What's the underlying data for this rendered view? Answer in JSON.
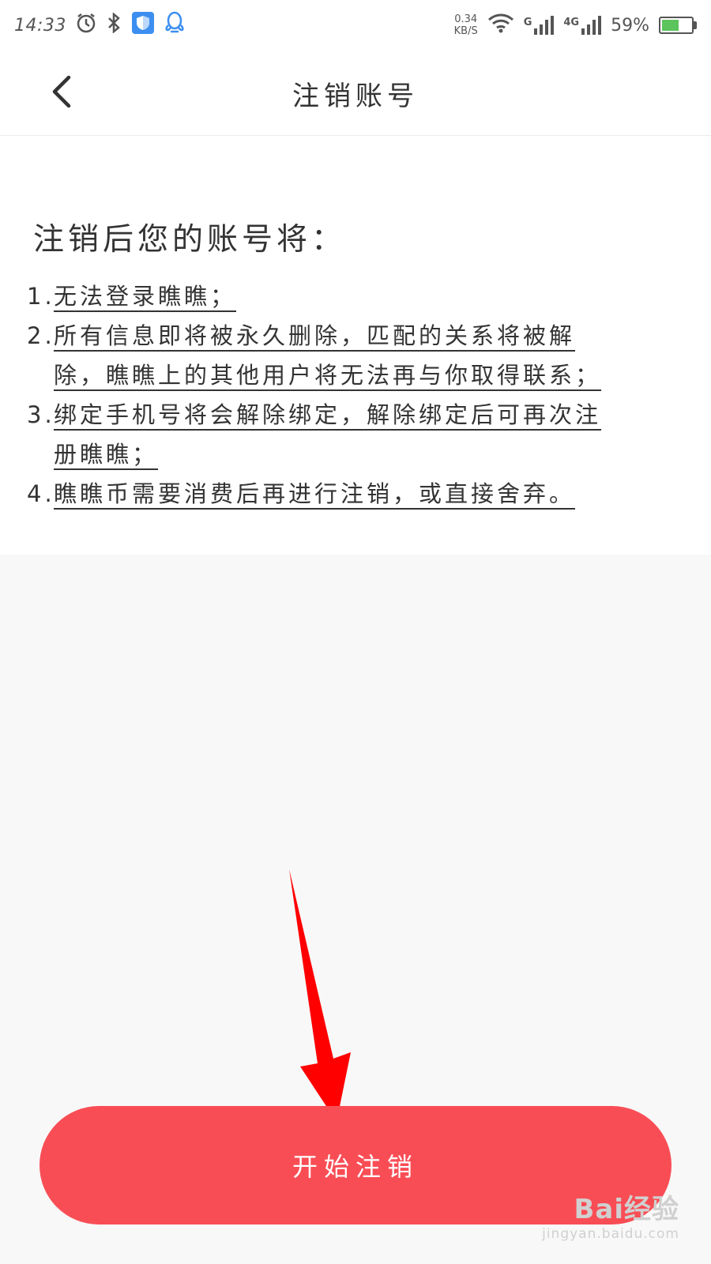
{
  "status_bar": {
    "time": "14:33",
    "net_speed_value": "0.34",
    "net_speed_unit": "KB/S",
    "network_1": "G",
    "network_2": "4G",
    "battery_percent": "59%",
    "battery_level": 0.59,
    "icons": [
      "alarm-icon",
      "bluetooth-icon",
      "shield-icon",
      "qq-icon",
      "wifi-icon",
      "signal-icon",
      "battery-icon"
    ]
  },
  "nav": {
    "back_icon": "chevron-left-icon",
    "title": "注销账号"
  },
  "content": {
    "heading": "注销后您的账号将：",
    "rules": [
      {
        "num": "1.",
        "text": "无法登录瞧瞧；"
      },
      {
        "num": "2.",
        "text": "所有信息即将被永久删除，匹配的关系将被解除，瞧瞧上的其他用户将无法再与你取得联系；"
      },
      {
        "num": "3.",
        "text": "绑定手机号将会解除绑定，解除绑定后可再次注册瞧瞧；"
      },
      {
        "num": "4.",
        "text": "瞧瞧币需要消费后再进行注销，或直接舍弃。"
      }
    ]
  },
  "action": {
    "start_label": "开始注销",
    "color": "#f94d55"
  },
  "annotation": {
    "arrow_color": "#ff0000"
  },
  "watermark": {
    "main": "Bai经验",
    "sub": "jingyan.baidu.com"
  }
}
